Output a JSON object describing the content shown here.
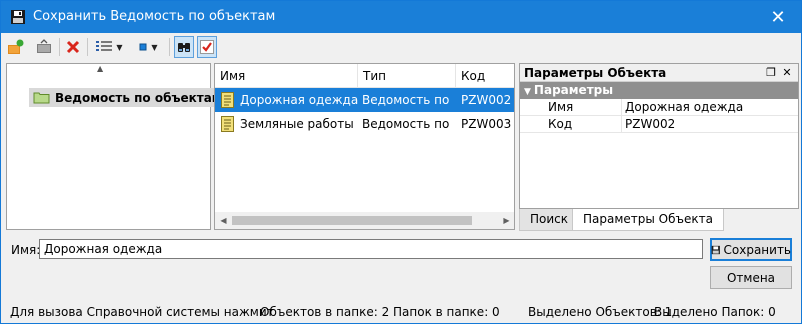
{
  "window": {
    "title": "Сохранить Ведомость по объектам",
    "close_glyph": "✕"
  },
  "toolbar": {
    "buttons": [
      {
        "icon": "open-object-icon"
      },
      {
        "icon": "go-up-folder-icon"
      },
      {
        "icon": "delete-icon"
      },
      {
        "icon": "view-mode-icon"
      },
      {
        "icon": "small-icons-view-icon"
      },
      {
        "icon": "find-icon"
      },
      {
        "icon": "check-icon"
      }
    ]
  },
  "tree": {
    "nodes": [
      {
        "label": "Ведомость по объектам",
        "icon": "folder-icon"
      }
    ]
  },
  "list": {
    "columns": [
      "Имя",
      "Тип",
      "Код"
    ],
    "rows": [
      {
        "name": "Дорожная одежда",
        "type": "Ведомость по ...",
        "code": "PZW002",
        "selected": true
      },
      {
        "name": "Земляные работы",
        "type": "Ведомость по ...",
        "code": "PZW003",
        "selected": false
      }
    ]
  },
  "properties": {
    "caption": "Параметры Объекта",
    "group": "Параметры",
    "rows": [
      {
        "key": "Имя",
        "value": "Дорожная одежда"
      },
      {
        "key": "Код",
        "value": "PZW002"
      }
    ],
    "tabs": [
      "Поиск",
      "Параметры Объекта"
    ],
    "active_tab": "Параметры Объекта"
  },
  "form": {
    "name_label": "Имя:",
    "name_value": "Дорожная одежда",
    "save_label": "Сохранить",
    "cancel_label": "Отмена"
  },
  "status": {
    "help": "Для вызова Справочной системы нажмит",
    "objects_in_folder": "Объектов в папке: 2",
    "folders_in_folder": "Папок в папке: 0",
    "selected_objects": "Выделено Объектов: 1",
    "selected_folders": "Выделено Папок: 0"
  },
  "colors": {
    "accent": "#1a7fd8",
    "delete": "#d9261c",
    "group_header": "#8f8f8f"
  }
}
